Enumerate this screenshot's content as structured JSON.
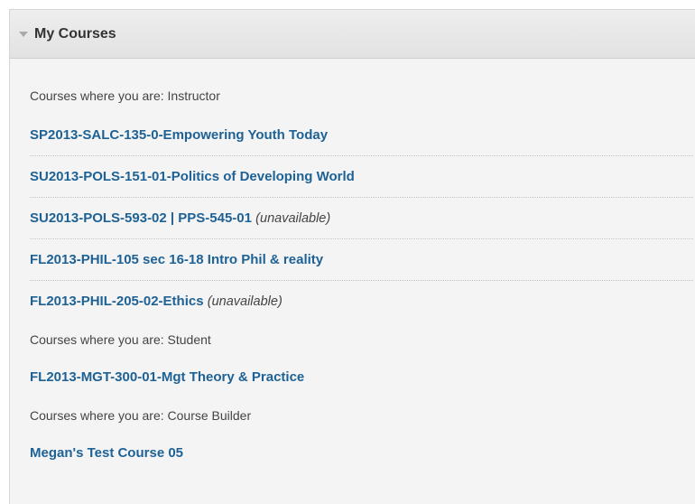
{
  "module": {
    "title": "My Courses"
  },
  "groups": [
    {
      "heading": "Courses where you are: Instructor",
      "courses": [
        {
          "name": "SP2013-SALC-135-0-Empowering Youth Today",
          "status": ""
        },
        {
          "name": "SU2013-POLS-151-01-Politics of Developing World",
          "status": ""
        },
        {
          "name": "SU2013-POLS-593-02 | PPS-545-01",
          "status": "(unavailable)"
        },
        {
          "name": "FL2013-PHIL-105 sec 16-18 Intro Phil & reality",
          "status": ""
        },
        {
          "name": "FL2013-PHIL-205-02-Ethics",
          "status": "(unavailable)"
        }
      ]
    },
    {
      "heading": "Courses where you are: Student",
      "courses": [
        {
          "name": "FL2013-MGT-300-01-Mgt Theory & Practice",
          "status": ""
        }
      ]
    },
    {
      "heading": "Courses where you are: Course Builder",
      "courses": [
        {
          "name": "Megan's Test Course 05",
          "status": ""
        }
      ]
    }
  ]
}
